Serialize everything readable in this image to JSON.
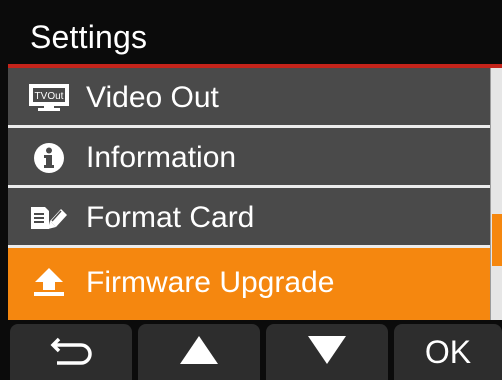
{
  "header": {
    "title": "Settings"
  },
  "menu": {
    "items": [
      {
        "label": "Video Out",
        "icon": "tv-out-icon",
        "selected": false
      },
      {
        "label": "Information",
        "icon": "info-icon",
        "selected": false
      },
      {
        "label": "Format Card",
        "icon": "format-card-icon",
        "selected": false
      },
      {
        "label": "Firmware Upgrade",
        "icon": "upload-icon",
        "selected": true
      }
    ]
  },
  "tv_out_icon_text": "TVOut",
  "nav": {
    "back_icon": "back-arrow-icon",
    "up_icon": "up-triangle-icon",
    "down_icon": "down-triangle-icon",
    "ok_label": "OK"
  },
  "colors": {
    "accent": "#f5870f",
    "header_rule": "#c4241b",
    "row_bg": "#4a4a4a",
    "background": "#0b0b0b"
  }
}
